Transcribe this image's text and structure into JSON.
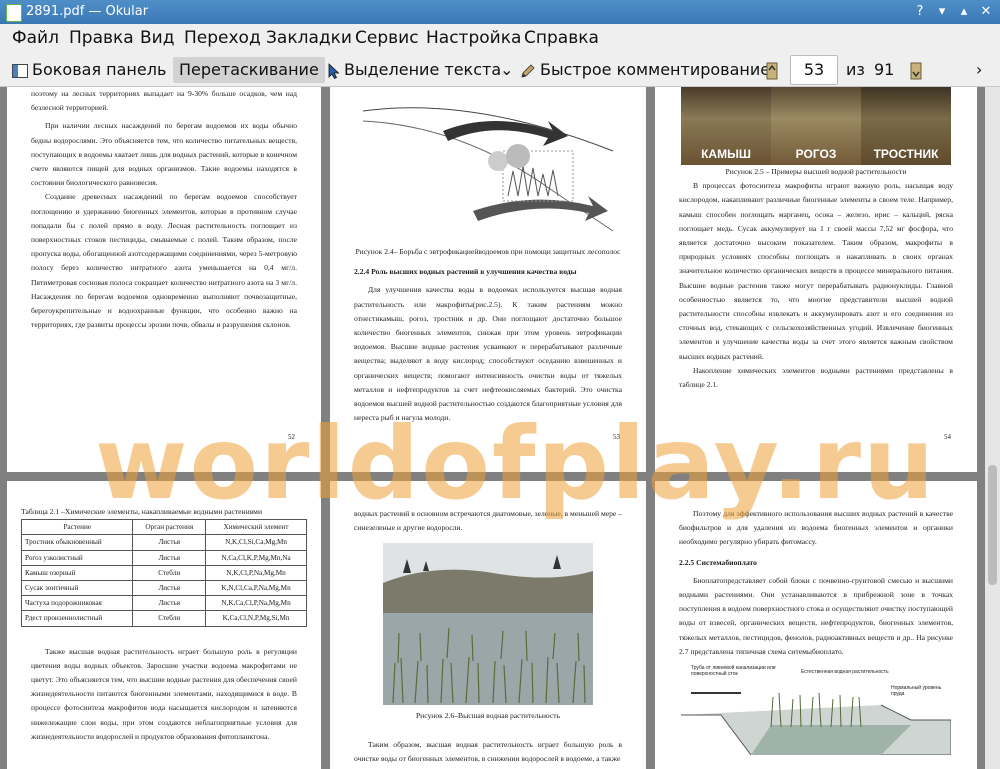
{
  "window": {
    "title": "2891.pdf — Okular"
  },
  "menu": [
    "Файл",
    "Правка",
    "Вид",
    "Переход",
    "Закладки",
    "Сервис",
    "Настройка",
    "Справка"
  ],
  "toolbar": {
    "sidebar": "Боковая панель",
    "browse": "Перетаскивание",
    "text_select": "Выделение текста",
    "annotate": "Быстрое комментирование",
    "page_current": "53",
    "page_of": "из",
    "page_total": "91"
  },
  "watermark": "worldofplay.ru",
  "pages": {
    "p52": {
      "lines": [
        "поэтому на лесных территориях выпадает на 9-30% больше осадков, чем над безлесной территорией.",
        "При наличии лесных насаждений по берегам водоемов их воды обычно бедны водорослями. Это объясняется тем, что количество питательных веществ, поступающих в водоемы хватает лишь для водных растений, которые в конечном счете являются пищей для водных организмов. Такие водоемы находятся в состоянии биологического равновесия.",
        "Создание древесных насаждений по берегам водоемов способствует поглощению и удержанию биогенных элементов, которые в противном случае попадали бы с полей прямо в воду. Лесная растительность поглощает из поверхностных стоков пестициды, смываемые с полей. Таким образом, после пропуска воды, обогащенной азотсодержащими соединениями, через 5-метровую полосу берез количество нитратного азота уменьшается на 0,4 мг/л. Пятиметровая сосновая полоса сокращает количество нитратного азота на 3 мг/л. Насаждения по берегам водоемов одновременно выполняют почвозащитные, берегоукрепительные и водоохранные функции, что особенно важно на территориях, где развиты процессы эрозии почв, обвалы и разрушения склонов."
      ],
      "num": "52"
    },
    "p53": {
      "caption": "Рисунок 2.4– Борьба с эвтрофикациейводоемов при помощи защитных лесополос",
      "heading": "2.2.4 Роль высших водных растений в улучшения качества воды",
      "text": "Для улучшения качества воды в водоемах используется высшая водная растительность или макрофиты(рис.2.5). К таким растениям можно отнестикамыш, рогоз, тростник и др. Они поглощают достаточно большое количество биогенных элементов, снижая при этом уровень эвтрофикации водоемов. Высшие водные растения усваивают и перерабатывают различные вещества; выделяют в воду кислород; способствуют оседанию взвешенных и органических веществ; помогают интенсивность очистки воды от тяжелых металлов и нефтепродуктов за счет нефтеокисляемых бактерий. Это очистка водоемов высшей водной растительностью создаются благоприятные условия для нереста рыб и нагула молоди.",
      "num": "53"
    },
    "p54": {
      "labels": [
        "КАМЫШ",
        "РОГОЗ",
        "ТРОСТНИК"
      ],
      "caption": "Рисунок 2.5 – Примеры высшей водной растительности",
      "text": "В процессах фотосинтеза макрофиты играют важную роль, насыщая воду кислородом, накапливают различные биогенные элементы в своем теле. Например, камыш способен поглощать марганец, осока – железо, ирис – кальций, ряска поглощает медь. Сусак аккумулирует на 1 г своей массы 7,52 мг фосфора, что является достаточно высоким показателем. Таким образом, макрофиты в природных условиях способны поглощать и накапливать в своих органах значительное количество органических веществ в процессе минерального питания. Высшие водные растения также могут перерабатывать радионуклиды. Главной особенностью является то, что многие представители высшей водной растительности способны извлекать и аккумулировать азот и его соединения из сточных вод, стекающих с сельскохозяйственных угодий. Извлечение биогенных элементов и улучшение качества воды за счет этого является важным свойством высших водных растений.",
      "text2": "Накопление химических элементов водными растениями представлены в таблице 2.1.",
      "num": "54"
    },
    "p55": {
      "table_title": "Таблица 2.1 –Химические элементы, накапливаемые водными растениями",
      "headers": [
        "Растение",
        "Орган растения",
        "Химический элемент"
      ],
      "rows": [
        [
          "Тростник обыкновенный",
          "Листья",
          "N,K,Cl,Si,Ca,Mg,Mn"
        ],
        [
          "Рогоз узколистный",
          "Листья",
          "N,Ca,Cl,K,P,Mg,Mn,Na"
        ],
        [
          "Камыш озерный",
          "Стебли",
          "N,K,Cl,P,Na,Mg,Mn"
        ],
        [
          "Сусак зонтичный",
          "Листья",
          "K,N,Cl,Ca,P,Na,Mg,Mn"
        ],
        [
          "Частуха подорожниковая",
          "Листья",
          "N,K,Ca,Cl,P,Na,Mg,Mn"
        ],
        [
          "Рдест пронзеннолистный",
          "Стебли",
          "K,Ca,Cl,N,P,Mg,Si,Mn"
        ]
      ],
      "text": "Также высшая водная растительность играет большую роль в регуляции цветения воды водных объектов. Заросшие участки водоема макрофитами не цветут. Это объясняется тем, что высшие водные растения для обеспечения своей жизнедеятельности питаются биогенными элементами, находящимися в воде. В процессе фотосинтеза макрофитов вода насыщается кислородом и затеняются нижележащие слои воды, при этом создаются неблагоприятные условия для жизнедеятельности водорослей и продуктов образования фитопланктона."
    },
    "p56": {
      "text_top": "водных растений в основном встречаются диатомовые, зеленые, в меньшей мере –синезеленые и другие водоросли.",
      "caption": "Рисунок 2.6–Высшая водная растительность",
      "text": "Таким образом, высшая водная растительность играет большую роль в очистке воды от биогенных элементов, в снижении водорослей в водоеме, а также"
    },
    "p57": {
      "text_top": "Поэтому для эффективного использования высших водных растений в качестве биофильтров и для удаления из водоема биогенных элементов и органики необходимо регулярно убирать фитомассу.",
      "heading": "2.2.5 Системабиоплато",
      "text": "Биоплатопредставляет собой блоки с почвенно-грунтовой смесью и высшими водными растениями. Они устанавливаются в прибрежной зоне в точках поступления в водоем поверхностного стока и осуществляют очистку поступающей воды от взвесей, органических веществ, нефтепродуктов, биогенных элементов, тяжелых металлов, пестицидов, фенолов, радиоактивных веществ и др.. На рисунке 2.7 представлена типичная схема ситемыбиоплато.",
      "fig_labels": [
        "Труба от ливневой канализации или поверхностный сток",
        "Естественная водная растительность",
        "Нормальный уровень пруда"
      ]
    }
  }
}
